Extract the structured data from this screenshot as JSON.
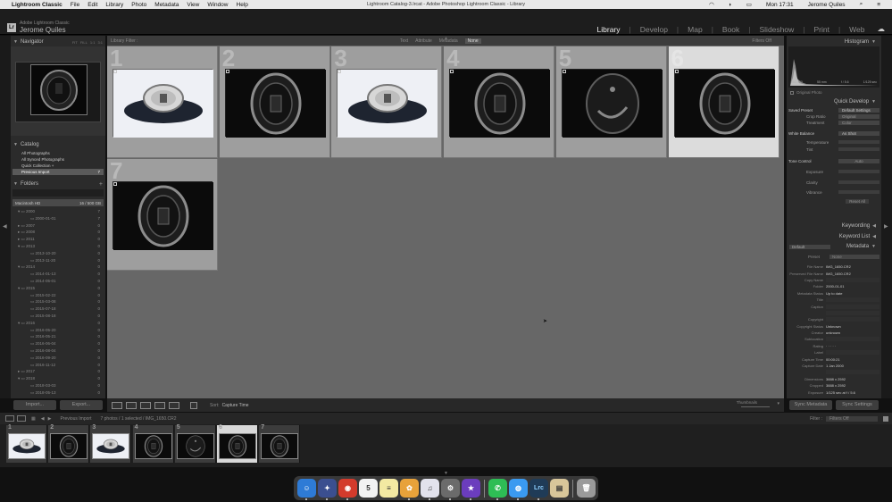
{
  "menubar": {
    "app_name": "Lightroom Classic",
    "items": [
      "File",
      "Edit",
      "Library",
      "Photo",
      "Metadata",
      "View",
      "Window",
      "Help"
    ],
    "window_title": "Lightroom Catalog-3.lrcat - Adobe Photoshop Lightroom Classic - Library",
    "time": "Mon 17:31",
    "user": "Jerome Quiles"
  },
  "header": {
    "product": "Adobe Lightroom Classic",
    "identity": "Jerome Quiles",
    "modules": [
      "Library",
      "Develop",
      "Map",
      "Book",
      "Slideshow",
      "Print",
      "Web"
    ],
    "active_module": "Library"
  },
  "left_panel": {
    "navigator_title": "Navigator",
    "navigator_zoom_options": [
      "FIT",
      "FILL",
      "1:1",
      "3:1"
    ],
    "catalog_title": "Catalog",
    "catalog_items": [
      {
        "label": "All Photographs",
        "count": ""
      },
      {
        "label": "All Synced Photographs",
        "count": ""
      },
      {
        "label": "Quick Collection +",
        "count": ""
      },
      {
        "label": "Previous Import",
        "count": "7"
      }
    ],
    "folders_title": "Folders",
    "volume": {
      "name": "Macintosh HD",
      "space": "16 / 500 GB"
    },
    "folders": [
      {
        "label": "2000",
        "count": "7",
        "level": 0,
        "expanded": true
      },
      {
        "label": "2000-01-01",
        "count": "7",
        "level": 1
      },
      {
        "label": "2007",
        "count": "",
        "level": 0
      },
      {
        "label": "2008",
        "count": "",
        "level": 0
      },
      {
        "label": "2011",
        "count": "",
        "level": 0
      },
      {
        "label": "2013",
        "count": "",
        "level": 0,
        "expanded": true
      },
      {
        "label": "2013-10-20",
        "count": "",
        "level": 1
      },
      {
        "label": "2013-11-20",
        "count": "",
        "level": 1
      },
      {
        "label": "2014",
        "count": "",
        "level": 0,
        "expanded": true
      },
      {
        "label": "2014-01-13",
        "count": "",
        "level": 1
      },
      {
        "label": "2014-05-01",
        "count": "",
        "level": 1
      },
      {
        "label": "2015",
        "count": "",
        "level": 0,
        "expanded": true
      },
      {
        "label": "2015-02-22",
        "count": "",
        "level": 1
      },
      {
        "label": "2015-03-08",
        "count": "",
        "level": 1
      },
      {
        "label": "2015-07-18",
        "count": "",
        "level": 1
      },
      {
        "label": "2015-08-18",
        "count": "",
        "level": 1
      },
      {
        "label": "2016",
        "count": "",
        "level": 0,
        "expanded": true
      },
      {
        "label": "2016-05-20",
        "count": "",
        "level": 1
      },
      {
        "label": "2016-05-21",
        "count": "",
        "level": 1
      },
      {
        "label": "2016-06-04",
        "count": "",
        "level": 1
      },
      {
        "label": "2016-08-04",
        "count": "",
        "level": 1
      },
      {
        "label": "2016-09-20",
        "count": "",
        "level": 1
      },
      {
        "label": "2016-11-12",
        "count": "",
        "level": 1
      },
      {
        "label": "2017",
        "count": "",
        "level": 0
      },
      {
        "label": "2018",
        "count": "",
        "level": 0,
        "expanded": true
      },
      {
        "label": "2018-03-03",
        "count": "",
        "level": 1
      },
      {
        "label": "2018-05-13",
        "count": "",
        "level": 1
      }
    ],
    "import_label": "Import...",
    "export_label": "Export..."
  },
  "filter_bar": {
    "title": "Library Filter :",
    "options": [
      "Text",
      "Attribute",
      "Metadata",
      "None"
    ],
    "active": "None",
    "state": "Filters Off"
  },
  "grid": {
    "cells": [
      {
        "num": "1",
        "style": "white",
        "selected": false
      },
      {
        "num": "2",
        "style": "dark",
        "selected": false
      },
      {
        "num": "3",
        "style": "white",
        "selected": false
      },
      {
        "num": "4",
        "style": "dark",
        "selected": false
      },
      {
        "num": "5",
        "style": "dark2",
        "selected": false
      },
      {
        "num": "6",
        "style": "dark",
        "selected": true
      },
      {
        "num": "7",
        "style": "dark",
        "selected": false
      }
    ]
  },
  "toolbar": {
    "sort_label": "Sort:",
    "sort_value": "Capture Time",
    "thumbnails_label": "Thumbnails"
  },
  "right_panel": {
    "histogram_title": "Histogram",
    "histogram_info": [
      "ISO 400",
      "55 mm",
      "f / 5.6",
      "1/125 sec"
    ],
    "original_photo": "Original Photo",
    "quick_develop_title": "Quick Develop",
    "saved_preset_label": "Saved Preset",
    "saved_preset_value": "Default Settings",
    "crop_ratio_label": "Crop Ratio",
    "crop_ratio_value": "Original",
    "treatment_label": "Treatment",
    "treatment_value": "Color",
    "white_balance_label": "White Balance",
    "white_balance_value": "As Shot",
    "temperature_label": "Temperature",
    "tint_label": "Tint",
    "tone_control_label": "Tone Control",
    "auto_label": "Auto",
    "exposure_label": "Exposure",
    "clarity_label": "Clarity",
    "vibrance_label": "Vibrance",
    "reset_label": "Reset All",
    "keywording_title": "Keywording",
    "keyword_list_title": "Keyword List",
    "metadata_title": "Metadata",
    "metadata_mode": "Default",
    "preset_label": "Preset",
    "preset_value": "None",
    "fields": [
      {
        "label": "File Name",
        "value": "IMG_1650.CR2"
      },
      {
        "label": "Preserved File Name",
        "value": "IMG_1650.CR2"
      },
      {
        "label": "Copy Name",
        "value": ""
      },
      {
        "label": "Folder",
        "value": "2000-01-01"
      },
      {
        "label": "Metadata Status",
        "value": "Up to date"
      },
      {
        "label": "Title",
        "value": ""
      },
      {
        "label": "Caption",
        "value": ""
      },
      {
        "label": "",
        "value": ""
      },
      {
        "label": "Copyright",
        "value": ""
      },
      {
        "label": "Copyright Status",
        "value": "Unknown"
      },
      {
        "label": "Creator",
        "value": "unknown"
      },
      {
        "label": "Sublocation",
        "value": ""
      },
      {
        "label": "Rating",
        "value": "· · · · ·"
      },
      {
        "label": "Label",
        "value": ""
      },
      {
        "label": "Capture Time",
        "value": "00:00:21"
      },
      {
        "label": "Capture Date",
        "value": "1 Jan 2000"
      },
      {
        "label": "",
        "value": ""
      },
      {
        "label": "Dimensions",
        "value": "3888 x 2592"
      },
      {
        "label": "Cropped",
        "value": "3888 x 2592"
      },
      {
        "label": "Exposure",
        "value": "1/125 sec at f / 5.6"
      }
    ],
    "sync_metadata_label": "Sync Metadata",
    "sync_settings_label": "Sync Settings"
  },
  "filmstrip_bar": {
    "source": "Previous Import",
    "count_text": "7 photos / 1 selected / IMG_1650.CR2",
    "filter_label": "Filter :",
    "filter_value": "Filters Off"
  },
  "filmstrip": {
    "cells": [
      {
        "num": "1",
        "style": "white"
      },
      {
        "num": "2",
        "style": "dark"
      },
      {
        "num": "3",
        "style": "white"
      },
      {
        "num": "4",
        "style": "dark"
      },
      {
        "num": "5",
        "style": "dark2"
      },
      {
        "num": "6",
        "style": "dark",
        "selected": true
      },
      {
        "num": "7",
        "style": "dark"
      }
    ]
  },
  "dock": {
    "apps": [
      {
        "name": "finder-icon",
        "glyph": "☺",
        "color": "#2e7bd6"
      },
      {
        "name": "launchpad-icon",
        "glyph": "✦",
        "color": "#3b4f8f"
      },
      {
        "name": "chrome-icon",
        "glyph": "◉",
        "color": "#d33b2c"
      },
      {
        "name": "calendar-icon",
        "glyph": "5",
        "color": "#f2f2f2"
      },
      {
        "name": "notes-icon",
        "glyph": "≡",
        "color": "#f3e9a2"
      },
      {
        "name": "photos-icon",
        "glyph": "✿",
        "color": "#e8a23a"
      },
      {
        "name": "itunes-icon",
        "glyph": "♫",
        "color": "#e2e2ec"
      },
      {
        "name": "system-preferences-icon",
        "glyph": "⚙",
        "color": "#6b6b6b"
      },
      {
        "name": "imovie-icon",
        "glyph": "★",
        "color": "#6b3dbd"
      },
      {
        "name": "whatsapp-icon",
        "glyph": "✆",
        "color": "#2ebd55"
      },
      {
        "name": "messages-icon",
        "glyph": "◍",
        "color": "#3a9af0"
      },
      {
        "name": "lightroom-icon",
        "glyph": "Lrc",
        "color": "#1f3b57"
      },
      {
        "name": "preview-icon",
        "glyph": "▤",
        "color": "#d8c69a"
      },
      {
        "name": "trash-icon",
        "glyph": "🗑",
        "color": "#9a9a9a"
      }
    ]
  }
}
